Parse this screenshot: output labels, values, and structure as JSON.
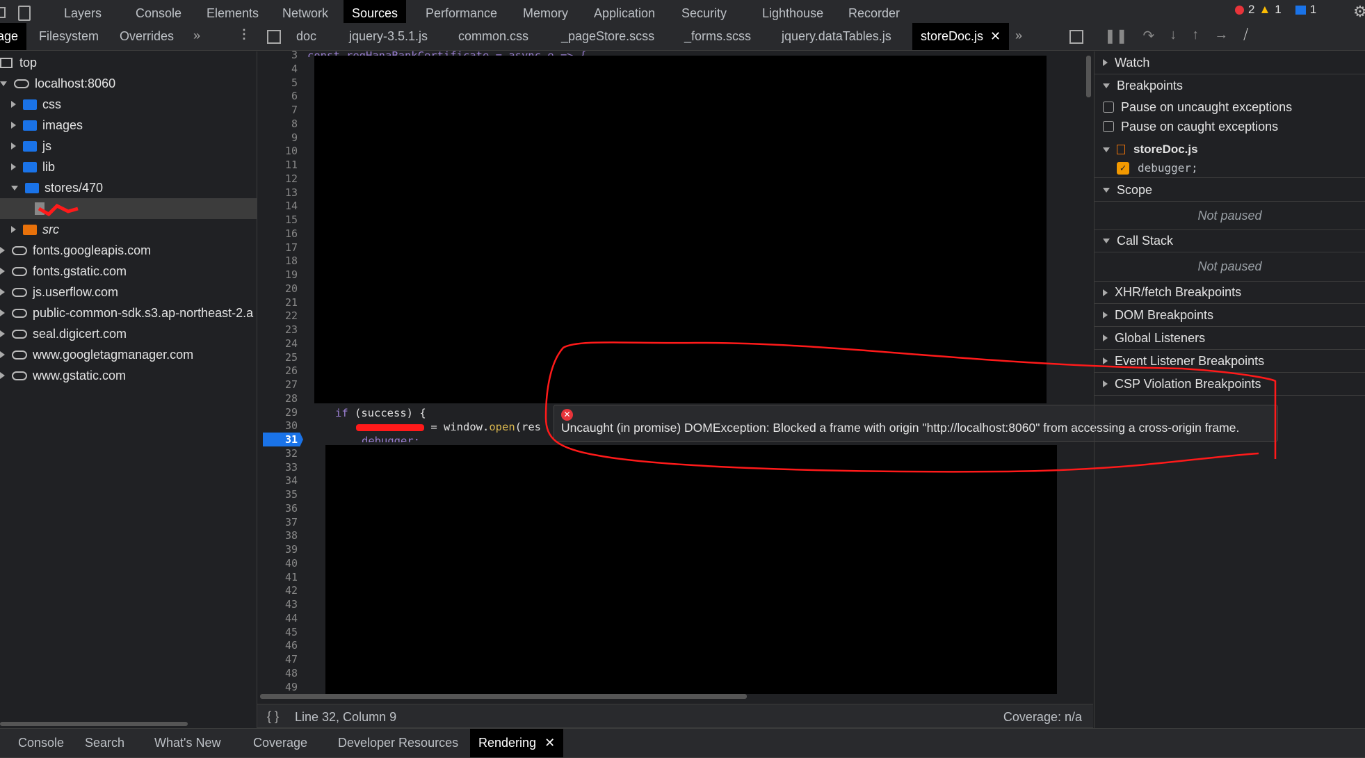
{
  "main_tabs": [
    "Layers",
    "Console",
    "Elements",
    "Network",
    "Sources",
    "Performance",
    "Memory",
    "Application",
    "Security",
    "Lighthouse",
    "Recorder"
  ],
  "active_main_tab": "Sources",
  "counts": {
    "errors": "2",
    "warnings": "1",
    "messages": "1"
  },
  "nav_tabs": [
    "age",
    "Filesystem",
    "Overrides"
  ],
  "file_tabs": [
    "doc",
    "jquery-3.5.1.js",
    "common.css",
    "_pageStore.scss",
    "_forms.scss",
    "jquery.dataTables.js",
    "storeDoc.js"
  ],
  "active_file": "storeDoc.js",
  "tree": [
    {
      "label": "top",
      "kind": "frame",
      "indent": 0
    },
    {
      "label": "localhost:8060",
      "kind": "cloud",
      "indent": 0,
      "open": true
    },
    {
      "label": "css",
      "kind": "folder",
      "indent": 1
    },
    {
      "label": "images",
      "kind": "folder",
      "indent": 1
    },
    {
      "label": "js",
      "kind": "folder",
      "indent": 1
    },
    {
      "label": "lib",
      "kind": "folder",
      "indent": 1
    },
    {
      "label": "stores/470",
      "kind": "folder",
      "indent": 1,
      "open": true
    },
    {
      "label": "",
      "kind": "file",
      "indent": 2
    },
    {
      "label": "src",
      "kind": "folder-orange",
      "indent": 1
    },
    {
      "label": "fonts.googleapis.com",
      "kind": "cloud",
      "indent": 0
    },
    {
      "label": "fonts.gstatic.com",
      "kind": "cloud",
      "indent": 0
    },
    {
      "label": "js.userflow.com",
      "kind": "cloud",
      "indent": 0
    },
    {
      "label": "public-common-sdk.s3.ap-northeast-2.a",
      "kind": "cloud",
      "indent": 0
    },
    {
      "label": "seal.digicert.com",
      "kind": "cloud",
      "indent": 0
    },
    {
      "label": "www.googletagmanager.com",
      "kind": "cloud",
      "indent": 0
    },
    {
      "label": "www.gstatic.com",
      "kind": "cloud",
      "indent": 0
    }
  ],
  "editor": {
    "first_line": 3,
    "last_line": 49,
    "active_line": 31,
    "line3": "const regHanaBankCertificate = async e => {",
    "line29_kw": "if",
    "line29_rest": " (success) {",
    "line30_eq": " = window.",
    "line30_fn": "open",
    "line30_rest": "(res",
    "line31": "debugger;"
  },
  "tooltip": "Uncaught (in promise) DOMException: Blocked a frame with origin \"http://localhost:8060\" from accessing a cross-origin frame.",
  "status": {
    "position": "Line 32, Column 9",
    "coverage": "Coverage: n/a"
  },
  "debugger": {
    "watch": "Watch",
    "breakpoints": "Breakpoints",
    "pause_uncaught": "Pause on uncaught exceptions",
    "pause_caught": "Pause on caught exceptions",
    "bp_file": "storeDoc.js",
    "bp_code": "debugger;",
    "scope": "Scope",
    "not_paused": "Not paused",
    "call_stack": "Call Stack",
    "more": [
      "XHR/fetch Breakpoints",
      "DOM Breakpoints",
      "Global Listeners",
      "Event Listener Breakpoints",
      "CSP Violation Breakpoints"
    ]
  },
  "drawer_tabs": [
    "Console",
    "Search",
    "What's New",
    "Coverage",
    "Developer Resources",
    "Rendering"
  ],
  "active_drawer": "Rendering",
  "colors": {
    "accent": "#1a73e8",
    "annotation": "#ff0000",
    "error": "#e8343a"
  }
}
